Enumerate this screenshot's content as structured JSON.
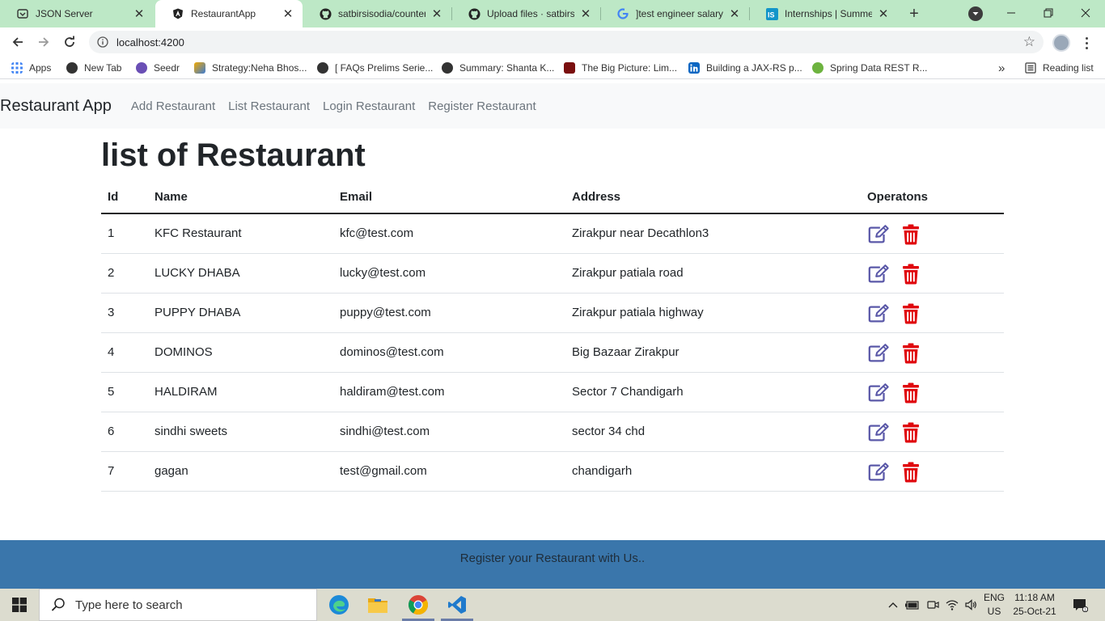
{
  "browser": {
    "tabs": [
      {
        "title": "JSON Server",
        "icon": "json-server-icon"
      },
      {
        "title": "RestaurantApp",
        "icon": "angular-icon"
      },
      {
        "title": "satbirsisodia/counter-",
        "icon": "github-icon"
      },
      {
        "title": "Upload files · satbirsisc",
        "icon": "github-icon"
      },
      {
        "title": "]test engineer salary in",
        "icon": "google-icon"
      },
      {
        "title": "Internships | Summer ",
        "icon": "internshala-icon"
      }
    ],
    "active_tab": 1,
    "url": "localhost:4200",
    "bookmarks": [
      "Apps",
      "New Tab",
      "Seedr",
      "Strategy:Neha Bhos...",
      "[ FAQs Prelims Serie...",
      "Summary: Shanta K...",
      "The Big Picture: Lim...",
      "Building a JAX-RS p...",
      "Spring Data REST R..."
    ],
    "reading_list": "Reading list",
    "overflow": "»"
  },
  "app": {
    "brand": "Restaurant App",
    "nav": [
      "Add Restaurant",
      "List Restaurant",
      "Login Restaurant",
      "Register Restaurant"
    ],
    "page_title": "list of Restaurant",
    "table": {
      "headers": [
        "Id",
        "Name",
        "Email",
        "Address",
        "Operatons"
      ],
      "rows": [
        {
          "id": "1",
          "name": "KFC Restaurant",
          "email": "kfc@test.com",
          "address": "Zirakpur near Decathlon3"
        },
        {
          "id": "2",
          "name": "LUCKY DHABA",
          "email": "lucky@test.com",
          "address": "Zirakpur patiala road"
        },
        {
          "id": "3",
          "name": "PUPPY DHABA",
          "email": "puppy@test.com",
          "address": "Zirakpur patiala highway"
        },
        {
          "id": "4",
          "name": "DOMINOS",
          "email": "dominos@test.com",
          "address": "Big Bazaar Zirakpur"
        },
        {
          "id": "5",
          "name": "HALDIRAM",
          "email": "haldiram@test.com",
          "address": "Sector 7 Chandigarh"
        },
        {
          "id": "6",
          "name": "sindhi sweets",
          "email": "sindhi@test.com",
          "address": "sector 34 chd"
        },
        {
          "id": "7",
          "name": "gagan",
          "email": "test@gmail.com",
          "address": "chandigarh"
        }
      ]
    },
    "footer": "Register your Restaurant with Us.."
  },
  "taskbar": {
    "search_placeholder": "Type here to search",
    "lang_top": "ENG",
    "lang_bottom": "US",
    "time": "11:18 AM",
    "date": "25-Oct-21"
  },
  "colors": {
    "edit_icon": "#5a58a8",
    "delete_icon": "#e0070d",
    "footer_bg": "#3a76ab",
    "tabstrip_bg": "#bde8c6"
  }
}
